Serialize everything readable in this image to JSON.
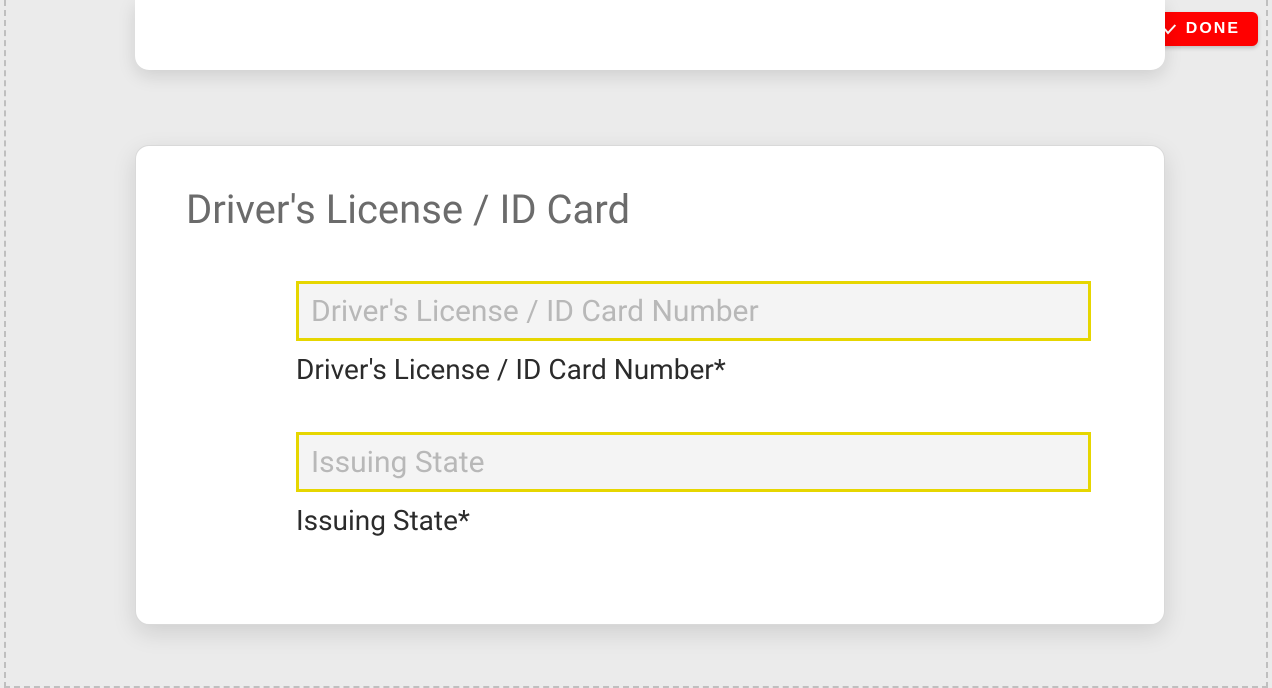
{
  "toolbar": {
    "done_label": "DONE"
  },
  "card": {
    "title": "Driver's License / ID Card",
    "fields": {
      "license_number": {
        "placeholder": "Driver's License / ID Card Number",
        "label": "Driver's License / ID Card Number*",
        "value": ""
      },
      "issuing_state": {
        "placeholder": "Issuing State",
        "label": "Issuing State*",
        "value": ""
      }
    }
  },
  "colors": {
    "accent_red": "#ff0000",
    "highlight_yellow": "#e6d600",
    "background": "#ebebeb"
  }
}
